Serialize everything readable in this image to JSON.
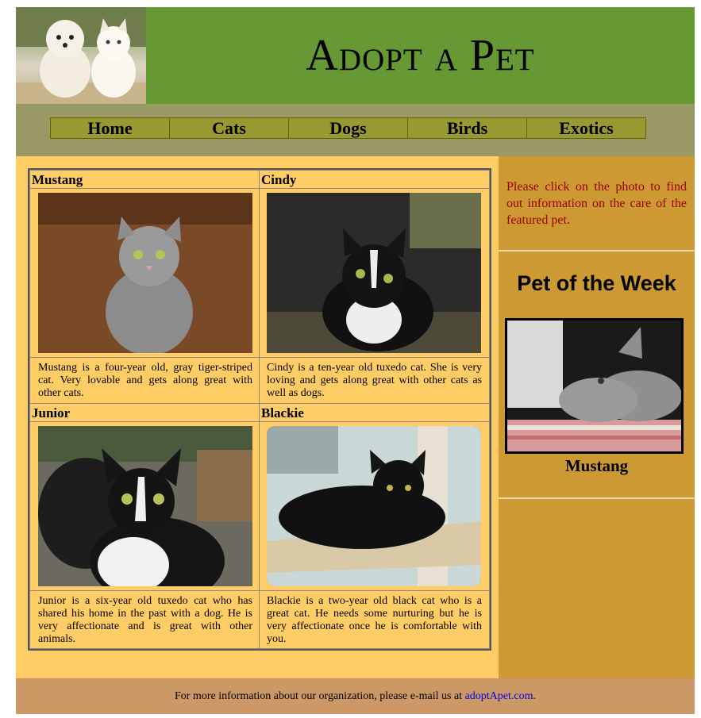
{
  "header": {
    "title": "Adopt a Pet"
  },
  "nav": {
    "items": [
      "Home",
      "Cats",
      "Dogs",
      "Birds",
      "Exotics"
    ]
  },
  "pets": [
    {
      "name": "Mustang",
      "description": "Mustang is a four-year old, gray tiger-striped cat. Very lovable and gets along great with other cats."
    },
    {
      "name": "Cindy",
      "description": "Cindy is a ten-year old tuxedo cat. She is very loving and gets along great with other cats as well as dogs."
    },
    {
      "name": "Junior",
      "description": "Junior is a six-year old tuxedo cat who has shared his home in the past with a dog. He is very affectionate and is great with other animals."
    },
    {
      "name": "Blackie",
      "description": "Blackie is a two-year old black cat who is a great cat. He needs some nurturing but he is very affectionate once he is comfortable with you."
    }
  ],
  "sidebar": {
    "note": "Please click on the photo to find out information on the care of the featured pet.",
    "heading": "Pet of the Week",
    "featured_name": "Mustang"
  },
  "footer": {
    "text": "For more information about our organization, please e-mail us at ",
    "link": "adoptApet.com",
    "suffix": "."
  },
  "colors": {
    "header_bg": "#669933",
    "nav_bg": "#999966",
    "content_bg": "#ffcc66",
    "sidebar_bg": "#cc9933",
    "footer_bg": "#cc9966",
    "note_text": "#990000",
    "link": "#0000ee"
  }
}
